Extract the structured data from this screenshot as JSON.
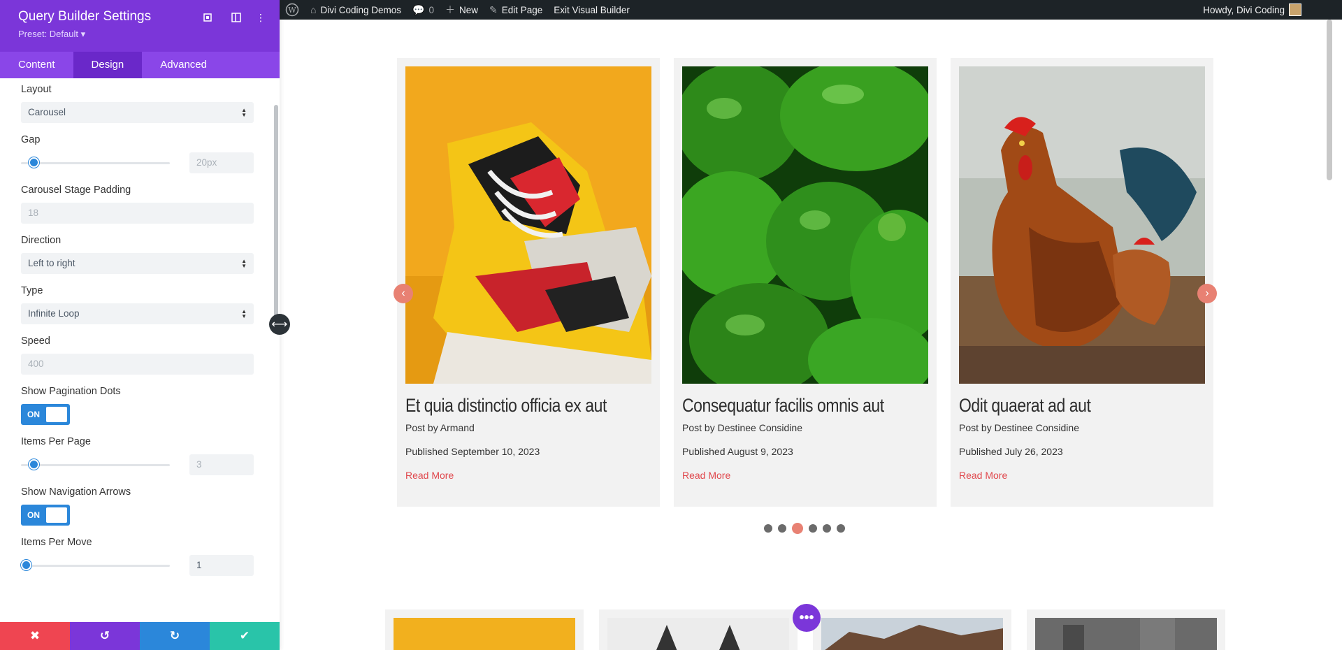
{
  "panel": {
    "title": "Query Builder Settings",
    "preset": "Preset: Default ▾",
    "tabs": [
      "Content",
      "Design",
      "Advanced"
    ],
    "active_tab": "Design",
    "settings": {
      "layout_label": "Layout",
      "layout_value": "Carousel",
      "gap_label": "Gap",
      "gap_value": "20px",
      "stage_padding_label": "Carousel Stage Padding",
      "stage_padding_placeholder": "18",
      "direction_label": "Direction",
      "direction_value": "Left to right",
      "type_label": "Type",
      "type_value": "Infinite Loop",
      "speed_label": "Speed",
      "speed_placeholder": "400",
      "pagination_label": "Show Pagination Dots",
      "pagination_state": "ON",
      "items_per_page_label": "Items Per Page",
      "items_per_page_value": "3",
      "nav_arrows_label": "Show Navigation Arrows",
      "nav_arrows_state": "ON",
      "items_per_move_label": "Items Per Move",
      "items_per_move_value": "1"
    },
    "bottom_buttons": {
      "close": "✖",
      "undo": "↺",
      "redo": "↻",
      "save": "✔"
    },
    "colors": {
      "header": "#7b36d9",
      "tabs": "#8a46e8",
      "close": "#ef4551",
      "undo": "#7b36d9",
      "redo": "#2b87da",
      "save": "#29c4a9"
    }
  },
  "adminbar": {
    "site_name": "Divi Coding Demos",
    "comments_count": "0",
    "new_label": "New",
    "edit_label": "Edit Page",
    "exit_label": "Exit Visual Builder",
    "greeting": "Howdy, Divi Coding"
  },
  "posts": [
    {
      "title": "Et quia distinctio officia ex aut",
      "author": "Post by Armand",
      "date": "Published September 10, 2023",
      "more": "Read More",
      "image": "sneaker"
    },
    {
      "title": "Consequatur facilis omnis aut",
      "author": "Post by Destinee Considine",
      "date": "Published August 9, 2023",
      "more": "Read More",
      "image": "green-peppers"
    },
    {
      "title": "Odit quaerat ad aut",
      "author": "Post by Destinee Considine",
      "date": "Published July 26, 2023",
      "more": "Read More",
      "image": "rooster"
    }
  ],
  "carousel": {
    "prev_icon": "‹",
    "next_icon": "›",
    "dots_total": 6,
    "active_dot": 3
  },
  "fab_label": "•••",
  "accent_color": "#e88173"
}
